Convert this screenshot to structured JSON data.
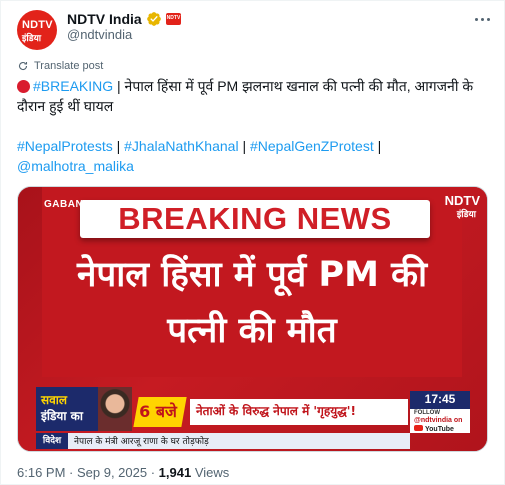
{
  "account": {
    "display_name": "NDTV India",
    "handle": "@ndtvindia",
    "avatar_text_top": "NDTV",
    "avatar_text_bottom": "इंडिया",
    "affiliate_badge_text": "NDTV",
    "verified_color": "#e8b600"
  },
  "translate_label": "Translate post",
  "tweet": {
    "line1_tag": "#BREAKING",
    "line1_rest": " | नेपाल हिंसा में पूर्व PM झलनाथ खनाल की पत्नी की मौत, आगजनी के",
    "line2": "दौरान हुई थीं घायल",
    "hashtags": [
      "#NepalProtests",
      "#JhalaNathKhanal",
      "#NepalGenZProtest"
    ],
    "separator": " | ",
    "mention": "@malhotra_malika"
  },
  "media": {
    "channel_tag": "GABANIT",
    "logo_top": "NDTV",
    "logo_bottom": "इंडिया",
    "breaking_label": "BREAKING NEWS",
    "headline_line1": "नेपाल हिंसा में पूर्व PM की",
    "headline_line2": "पत्नी की मौत",
    "show_line1": "सवाल",
    "show_line2": "इंडिया का",
    "time_slot": "6 बजे",
    "ticker_main": "नेताओं के विरुद्ध नेपाल में 'गृहयुद्ध'!",
    "clock": "17:45",
    "follow_label": "FOLLOW",
    "follow_handle": "@ndtvindia on",
    "follow_platform": "YouTube",
    "strip_label": "विदेश",
    "strip_text": "नेपाल के मंत्री आरजू राणा के घर तोड़फोड़"
  },
  "meta": {
    "time": "6:16 PM",
    "dot": " · ",
    "date": "Sep 9, 2025",
    "views_count": "1,941",
    "views_label": " Views"
  },
  "colors": {
    "link": "#1d9bf0",
    "brand_red": "#e2231a",
    "breaking_red": "#d01f27"
  }
}
